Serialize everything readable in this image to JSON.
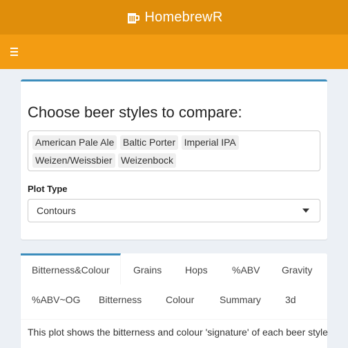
{
  "app": {
    "title": "HomebrewR",
    "logo_icon": "beer-mug-icon"
  },
  "header": {
    "menu_icon": "hamburger-icon"
  },
  "selector": {
    "heading": "Choose beer styles to compare:",
    "selected_styles": [
      "American Pale Ale",
      "Baltic Porter",
      "Imperial IPA",
      "Weizen/Weissbier",
      "Weizenbock"
    ],
    "plot_type_label": "Plot Type",
    "plot_type_value": "Contours"
  },
  "tabs": {
    "row1": [
      "Bitterness&Colour",
      "Grains",
      "Hops",
      "%ABV",
      "Gravity"
    ],
    "row2": [
      "%ABV~OG",
      "Bitterness",
      "Colour",
      "Summary",
      "3d"
    ],
    "active": "Bitterness&Colour"
  },
  "tab_content": {
    "description": "This plot shows the bitterness and colour 'signature' of each beer style"
  },
  "colors": {
    "logo_bar": "#e08e0b",
    "nav_bar": "#f39c12",
    "accent": "#3c8dbc",
    "background": "#ecf0f5"
  }
}
